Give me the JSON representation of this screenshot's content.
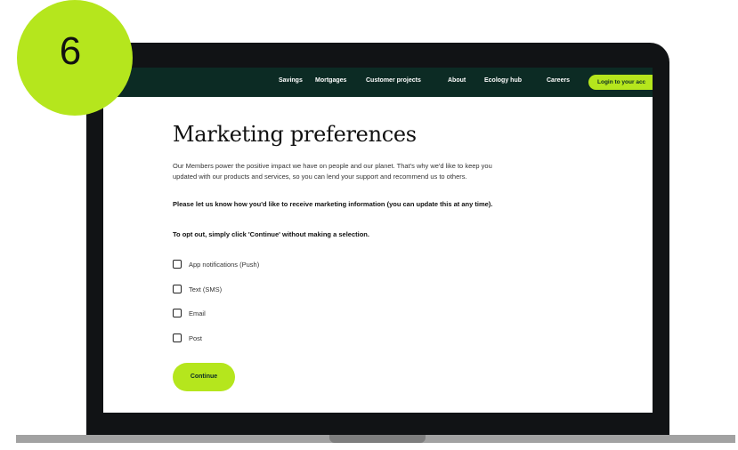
{
  "badge": {
    "step_number": "6"
  },
  "nav": {
    "links": [
      "Savings",
      "Mortgages",
      "Customer projects",
      "About",
      "Ecology hub",
      "Careers"
    ],
    "login_label": "Login to your acc"
  },
  "main": {
    "title": "Marketing preferences",
    "intro": "Our Members power the positive impact we have on people and our planet. That's why we'd like to keep you updated with our products and services, so you can lend your support and recommend us to others.",
    "instruction": "Please let us know how you'd like to receive marketing information (you can update this at any time).",
    "opt_out": "To opt out, simply click 'Continue' without making a selection.",
    "options": [
      {
        "label": "App notifications (Push)",
        "checked": false
      },
      {
        "label": "Text (SMS)",
        "checked": false
      },
      {
        "label": "Email",
        "checked": false
      },
      {
        "label": "Post",
        "checked": false
      }
    ],
    "continue_label": "Continue"
  },
  "colors": {
    "accent": "#b5e61d",
    "nav_bg": "#0c2b24",
    "laptop_frame": "#111315"
  }
}
